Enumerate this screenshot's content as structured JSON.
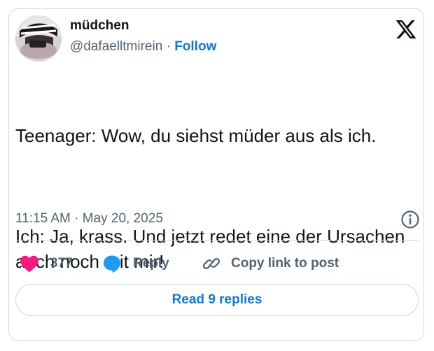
{
  "author": {
    "display_name": "müdchen",
    "handle": "@dafaelltmirein",
    "separator": "·",
    "follow_label": "Follow"
  },
  "tweet": {
    "paragraphs": [
      "Teenager: Wow, du siehst müder aus als ich.",
      "Ich: Ja, krass. Und jetzt redet eine der Ursachen auch noch mit mir!"
    ],
    "timestamp": "11:15 AM · May 20, 2025"
  },
  "actions": {
    "like_count": "377",
    "reply_label": "Reply",
    "copy_link_label": "Copy link to post"
  },
  "read_replies_label": "Read 9 replies",
  "icons": {
    "brand": "x-logo-icon",
    "info": "info-icon",
    "like": "heart-icon",
    "reply": "speech-bubble-icon",
    "copy": "link-icon"
  },
  "colors": {
    "like": "#f91880",
    "reply": "#1d9bf0",
    "link": "#0f7ad6",
    "secondary_text": "#536471",
    "border": "#cfd9de"
  }
}
